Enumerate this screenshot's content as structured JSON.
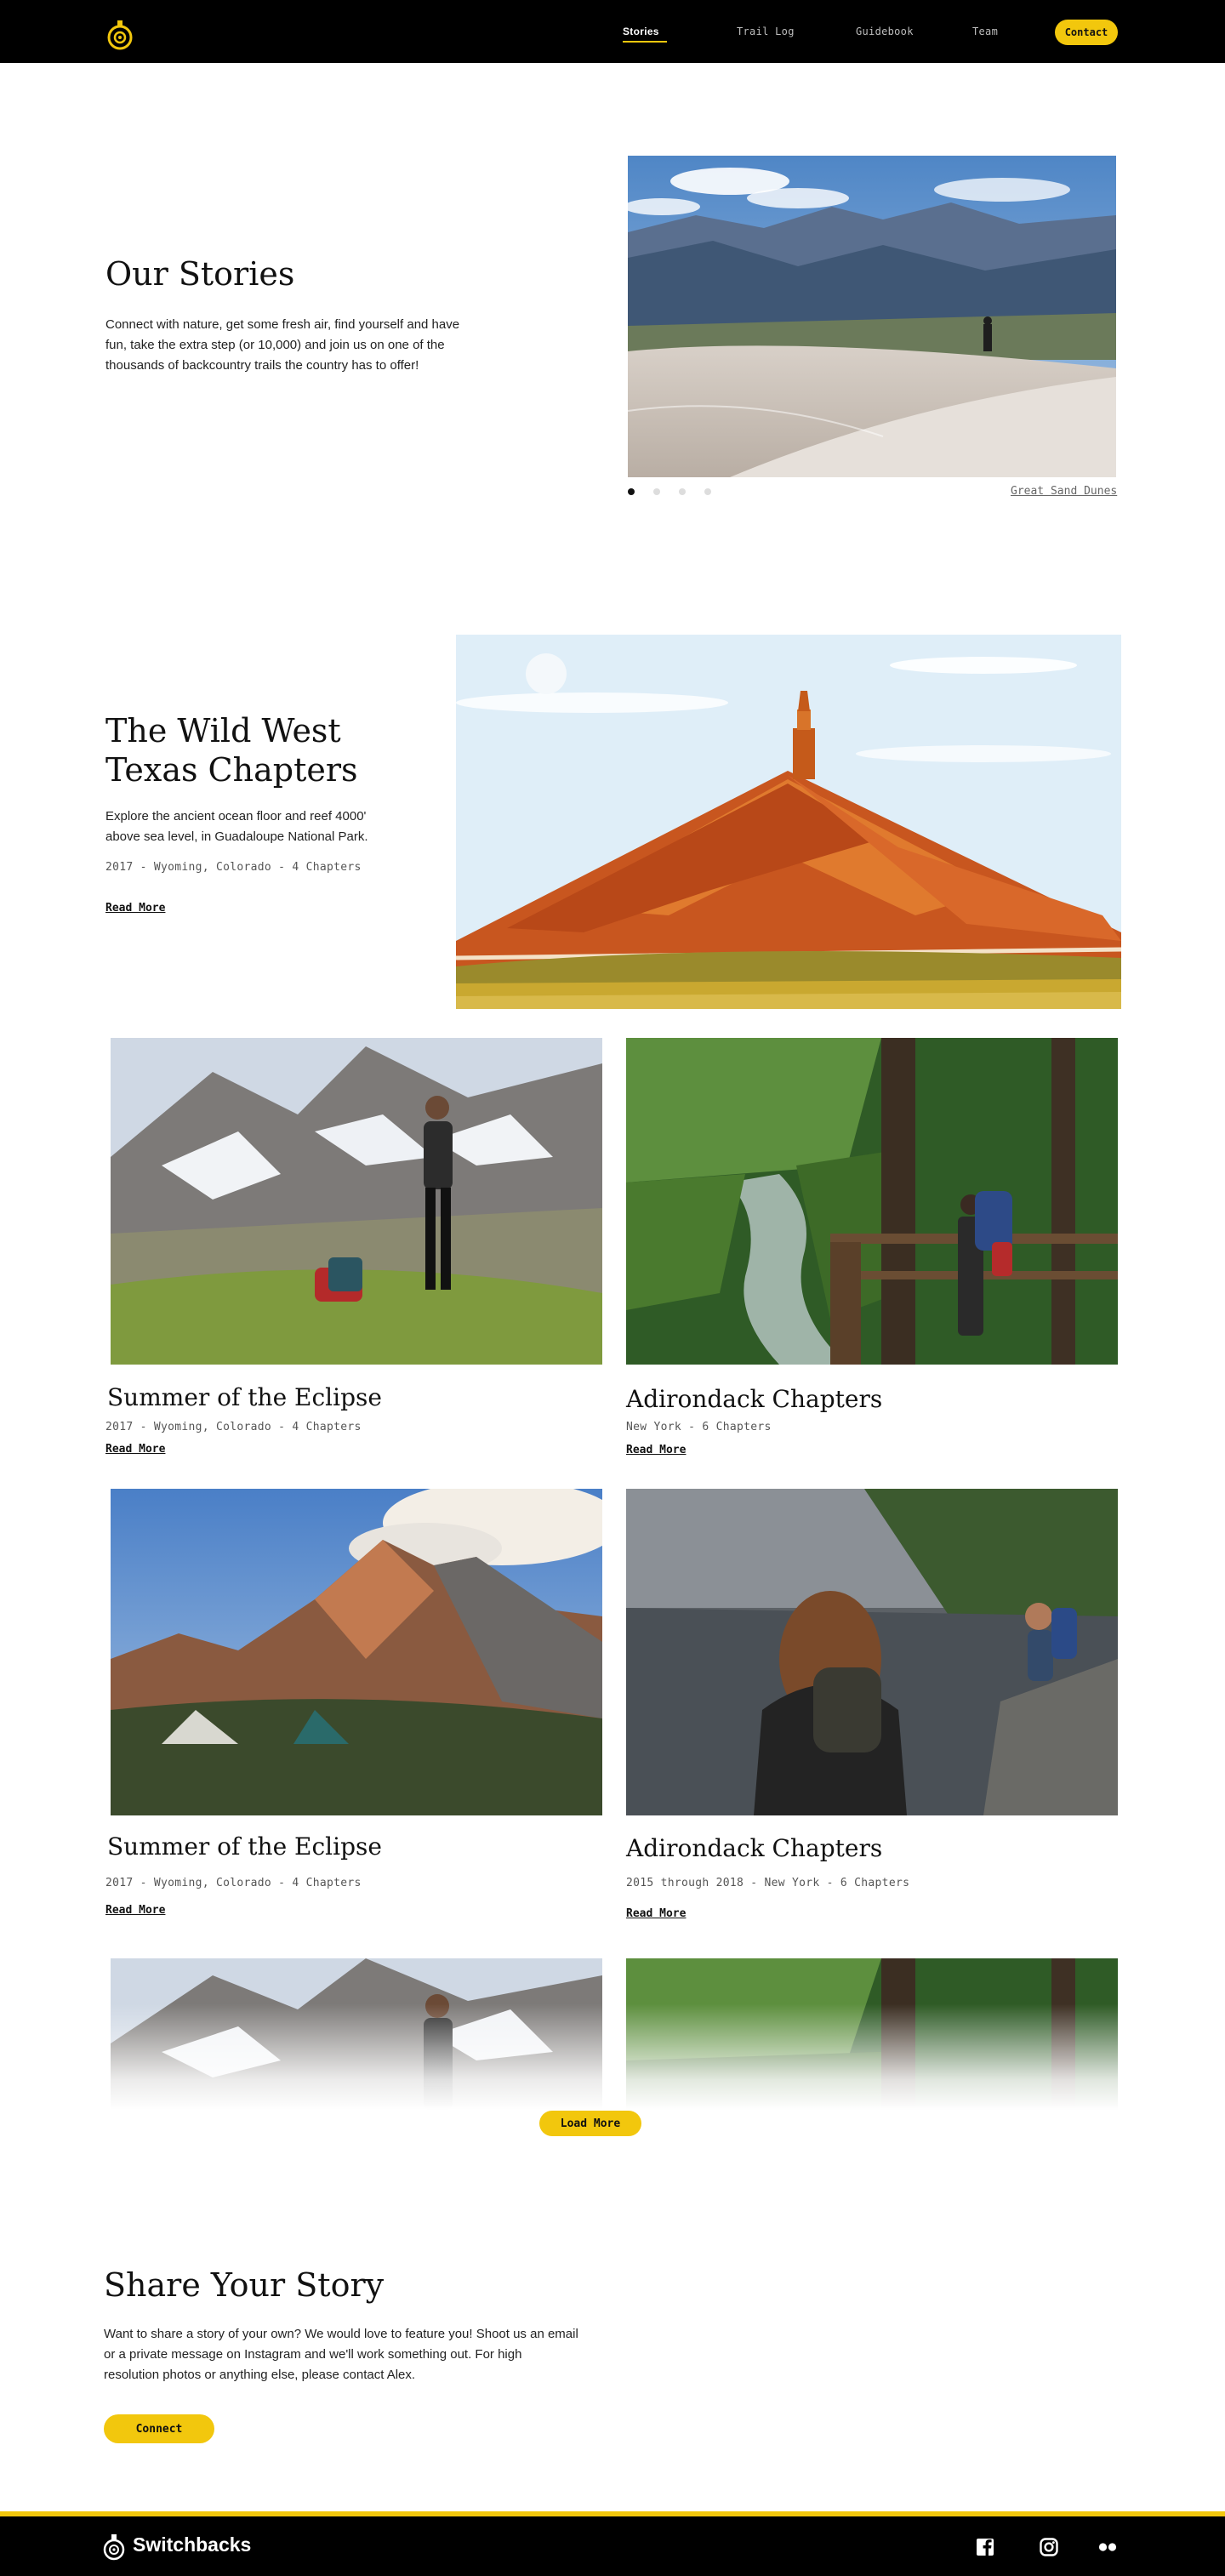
{
  "nav": {
    "items": [
      "Stories",
      "Trail Log",
      "Guidebook",
      "Team"
    ],
    "contact": "Contact"
  },
  "hero": {
    "title": "Our Stories",
    "text": "Connect with nature, get some fresh air, find yourself and have fun, take the extra step (or 10,000) and join us on one of the thousands of backcountry trails the country has to offer!",
    "caption": "Great Sand Dunes",
    "slide_count": 4,
    "active_slide": 1
  },
  "feature": {
    "title": "The Wild West Texas Chapters",
    "text": "Explore the ancient ocean floor and reef 4000' above sea level, in Guadaloupe National Park.",
    "meta": "2017  -  Wyoming, Colorado  -  4 Chapters",
    "read_more": "Read More"
  },
  "cards": [
    {
      "title": "Summer of the Eclipse",
      "meta": "2017  -  Wyoming, Colorado  -  4 Chapters",
      "read_more": "Read More"
    },
    {
      "title": "Adirondack Chapters",
      "meta": "New York  -  6 Chapters",
      "read_more": "Read More"
    },
    {
      "title": "Summer of the Eclipse",
      "meta": "2017  -  Wyoming, Colorado  -  4 Chapters",
      "read_more": "Read More"
    },
    {
      "title": "Adirondack Chapters",
      "meta": "2015 through 2018  -  New York  -  6 Chapters",
      "read_more": "Read More"
    }
  ],
  "load_more": "Load More",
  "share": {
    "title": "Share Your Story",
    "text": "Want to share a story of your own? We would love to feature you! Shoot us an email or a private message on Instagram and we'll work something out. For high resolution photos or anything else, please contact Alex.",
    "button": "Connect"
  },
  "footer": {
    "brand": "Switchbacks",
    "social_icons": [
      "facebook-icon",
      "instagram-icon",
      "flickr-icon"
    ]
  },
  "colors": {
    "accent": "#f2c70d",
    "header_bg": "#000000",
    "text": "#111111"
  }
}
